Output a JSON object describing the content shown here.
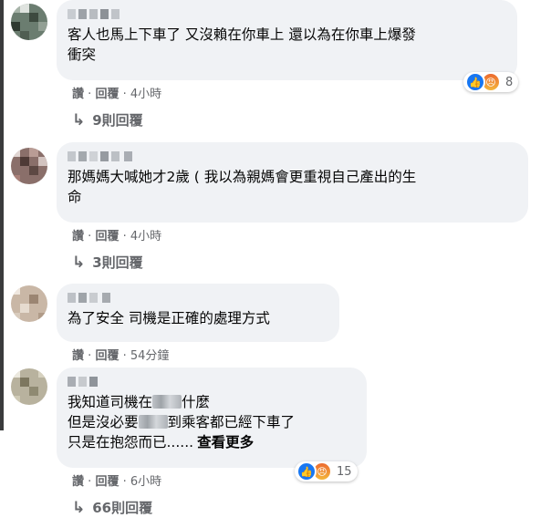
{
  "colors": {
    "bubble": "#f0f2f5",
    "meta": "#65676b",
    "like": "#1877f2",
    "angry": "#ef6c2e"
  },
  "labels": {
    "like": "讚",
    "reply": "回覆",
    "sep": "·"
  },
  "comments": [
    {
      "text": "客人也馬上下車了 又沒賴在你車上 還以為在你車上爆發\n衝突",
      "time": "4小時",
      "reactions": {
        "icons": [
          "like-icon",
          "angry-icon"
        ],
        "count": "8"
      },
      "replies": "9則回覆"
    },
    {
      "text": "那媽媽大喊她才2歲 ( 我以為親媽會更重視自己產出的生\n命",
      "time": "4小時",
      "replies": "3則回覆"
    },
    {
      "text": "為了安全 司機是正確的處理方式",
      "time": "54分鐘"
    },
    {
      "line1_a": "我知道司機在",
      "line1_b": "什麼",
      "line2_a": "但是沒必要",
      "line2_b": "到乘客都已經下車了",
      "line3": "只是在抱怨而已......",
      "see_more": "查看更多",
      "time": "6小時",
      "reactions": {
        "icons": [
          "like-icon",
          "angry-icon"
        ],
        "count": "15"
      },
      "replies": "66則回覆"
    }
  ]
}
